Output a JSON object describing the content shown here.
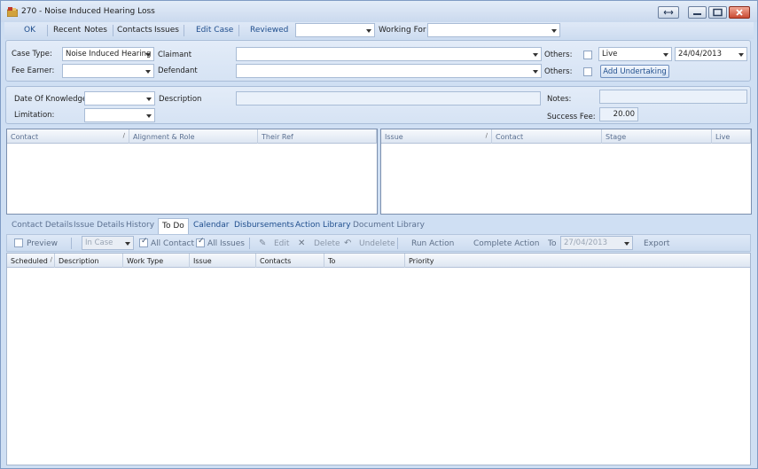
{
  "window": {
    "title": "270 - Noise Induced Hearing Loss"
  },
  "toolbar": {
    "ok": "OK",
    "recent": "Recent",
    "notes": "Notes",
    "contacts": "Contacts",
    "issues": "Issues",
    "edit_case": "Edit Case",
    "reviewed": "Reviewed",
    "reviewed_value": "",
    "working_for_label": "Working For",
    "working_for_value": ""
  },
  "case": {
    "case_type_label": "Case Type:",
    "case_type_value": "Noise Induced Hearing",
    "fee_earner_label": "Fee Earner:",
    "fee_earner_value": "",
    "claimant_label": "Claimant",
    "claimant_value": "",
    "defendant_label": "Defendant",
    "defendant_value": "",
    "others_label_1": "Others:",
    "others_label_2": "Others:",
    "status_value": "Live",
    "date_value": "24/04/2013",
    "add_undertaking": "Add Undertaking"
  },
  "details": {
    "date_of_knowledge_label": "Date Of Knowledge",
    "date_of_knowledge_value": "",
    "limitation_label": "Limitation:",
    "limitation_value": "",
    "description_label": "Description",
    "description_value": "",
    "notes_label": "Notes:",
    "notes_value": "",
    "success_fee_label": "Success Fee:",
    "success_fee_value": "20.00"
  },
  "contacts_grid": {
    "columns": [
      "Contact",
      "Alignment & Role",
      "Their Ref"
    ],
    "rows": []
  },
  "issues_grid": {
    "columns": [
      "Issue",
      "Contact",
      "Stage",
      "Live"
    ],
    "rows": []
  },
  "tabs": [
    "Contact Details",
    "Issue Details",
    "History",
    "To Do",
    "Calendar",
    "Disbursements",
    "Action Library",
    "Document Library"
  ],
  "active_tab": "To Do",
  "todo_toolbar": {
    "preview": "Preview",
    "in_case": "In Case",
    "all_contact": "All Contact",
    "all_issues": "All Issues",
    "edit": "Edit",
    "delete": "Delete",
    "undelete": "Undelete",
    "run_action": "Run Action",
    "complete_action": "Complete Action",
    "to_label": "To",
    "to_date": "27/04/2013",
    "export": "Export"
  },
  "todo_grid": {
    "columns": [
      "Scheduled",
      "Description",
      "Work Type",
      "Issue",
      "Contacts",
      "To",
      "Priority"
    ],
    "rows": []
  }
}
